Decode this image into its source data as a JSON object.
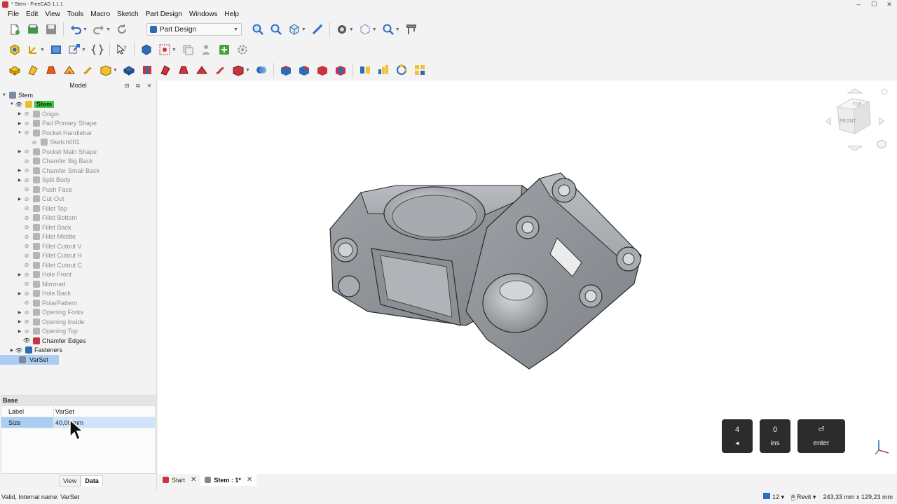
{
  "window": {
    "title": "* Stem - FreeCAD 1.1.1",
    "controls": [
      "–",
      "☐",
      "✕"
    ]
  },
  "menu": [
    "File",
    "Edit",
    "View",
    "Tools",
    "Macro",
    "Sketch",
    "Part Design",
    "Windows",
    "Help"
  ],
  "toolbar": {
    "workbench": "Part Design"
  },
  "model_panel": {
    "title": "Model",
    "controls": [
      "⊟",
      "⧉",
      "✕"
    ],
    "root": "Stem",
    "body": "Stem",
    "items": [
      {
        "label": "Origin",
        "indent": 2,
        "expandable": true,
        "visible": false
      },
      {
        "label": "Pad Primary Shape",
        "indent": 2,
        "expandable": true,
        "visible": false
      },
      {
        "label": "Pocket Handlebar",
        "indent": 2,
        "expandable": true,
        "expanded": true,
        "visible": false
      },
      {
        "label": "Sketch001",
        "indent": 3,
        "expandable": false,
        "visible": false
      },
      {
        "label": "Pocket Main Shape",
        "indent": 2,
        "expandable": true,
        "visible": false
      },
      {
        "label": "Chamfer Big Back",
        "indent": 2,
        "expandable": false,
        "visible": false
      },
      {
        "label": "Chamfer Small Back",
        "indent": 2,
        "expandable": true,
        "visible": false
      },
      {
        "label": "Split Body",
        "indent": 2,
        "expandable": true,
        "visible": false
      },
      {
        "label": "Push Face",
        "indent": 2,
        "expandable": false,
        "visible": false
      },
      {
        "label": "Cut-Out",
        "indent": 2,
        "expandable": true,
        "visible": false
      },
      {
        "label": "Fillet Top",
        "indent": 2,
        "expandable": false,
        "visible": false
      },
      {
        "label": "Fillet Bottom",
        "indent": 2,
        "expandable": false,
        "visible": false
      },
      {
        "label": "Fillet Back",
        "indent": 2,
        "expandable": false,
        "visible": false
      },
      {
        "label": "Fillet Middle",
        "indent": 2,
        "expandable": false,
        "visible": false
      },
      {
        "label": "Fillet Cutout V",
        "indent": 2,
        "expandable": false,
        "visible": false
      },
      {
        "label": "Fillet Cutout H",
        "indent": 2,
        "expandable": false,
        "visible": false
      },
      {
        "label": "Fillet Cutout C",
        "indent": 2,
        "expandable": false,
        "visible": false
      },
      {
        "label": "Hole Front",
        "indent": 2,
        "expandable": true,
        "visible": false
      },
      {
        "label": "Mirrored",
        "indent": 2,
        "expandable": false,
        "visible": false
      },
      {
        "label": "Hole Back",
        "indent": 2,
        "expandable": true,
        "visible": false
      },
      {
        "label": "PolarPattern",
        "indent": 2,
        "expandable": false,
        "visible": false
      },
      {
        "label": "Opening Forks",
        "indent": 2,
        "expandable": true,
        "visible": false
      },
      {
        "label": "Opening Inside",
        "indent": 2,
        "expandable": true,
        "visible": false
      },
      {
        "label": "Opening Top",
        "indent": 2,
        "expandable": true,
        "visible": false
      },
      {
        "label": "Chamfer Edges",
        "indent": 2,
        "expandable": false,
        "visible": true
      }
    ],
    "fasteners": "Fasteners",
    "varset": "VarSet"
  },
  "properties": {
    "group": "Base",
    "rows": [
      {
        "key": "Label",
        "value": "VarSet"
      },
      {
        "key": "Size",
        "value": "40,00 mm"
      }
    ],
    "tabs": [
      "View",
      "Data"
    ]
  },
  "navcube": {
    "top": "TOP",
    "front": "FRONT",
    "right": "RIGHT"
  },
  "keys": [
    {
      "top": "4",
      "bottom": "◂"
    },
    {
      "top": "0",
      "bottom": "ins"
    },
    {
      "top": "⏎",
      "bottom": "enter"
    }
  ],
  "doc_tabs": [
    "Start",
    "Stem : 1*"
  ],
  "status": {
    "message": "Valid, Internal name: VarSet",
    "count": "12",
    "nav_style": "Revit",
    "dimensions": "243,33 mm x 129,23 mm"
  },
  "colors": {
    "selection_green": "#3ec43e",
    "selection_blue": "#a9cdf3",
    "model_grey": "#9a9ea3"
  }
}
